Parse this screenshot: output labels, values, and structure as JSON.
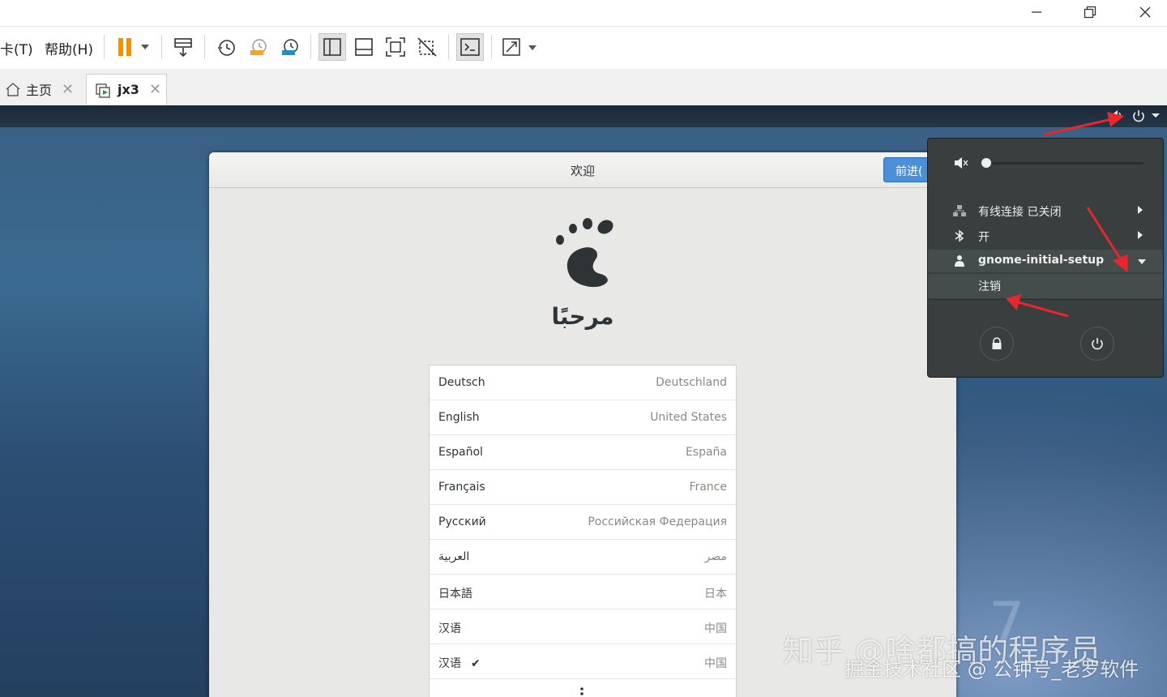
{
  "menubar": {
    "items": [
      {
        "label": "卡(T)"
      },
      {
        "label": "帮助(H)"
      }
    ]
  },
  "tabs": [
    {
      "label": "主页"
    },
    {
      "label": "jx3"
    }
  ],
  "dialog": {
    "title": "欢迎",
    "next_label": "前进(",
    "welcome_text": "مرحبًا"
  },
  "languages": [
    {
      "name": "Deutsch",
      "region": "Deutschland"
    },
    {
      "name": "English",
      "region": "United States"
    },
    {
      "name": "Español",
      "region": "España"
    },
    {
      "name": "Français",
      "region": "France"
    },
    {
      "name": "Русский",
      "region": "Российская Федерация"
    },
    {
      "name": "العربية",
      "region": "مصر"
    },
    {
      "name": "日本語",
      "region": "日本"
    },
    {
      "name": "汉语",
      "region": "中国"
    },
    {
      "name": "汉语",
      "region": "中国",
      "selected": true
    }
  ],
  "system_menu": {
    "volume_level": 0.03,
    "items": [
      {
        "label": "有线连接 已关闭"
      },
      {
        "label": "开"
      },
      {
        "label": "gnome-initial-setup"
      }
    ],
    "logout_label": "注销"
  },
  "desktop": {
    "version_mark": "7"
  },
  "watermark": {
    "line1": "知乎 @啥都搞的程序员",
    "line2": "掘金技术社区 @ 公钟号_老罗软件"
  },
  "colors": {
    "accent": "#4a90d9",
    "popup_bg": "#393f3f",
    "annotation": "#e8262b"
  }
}
